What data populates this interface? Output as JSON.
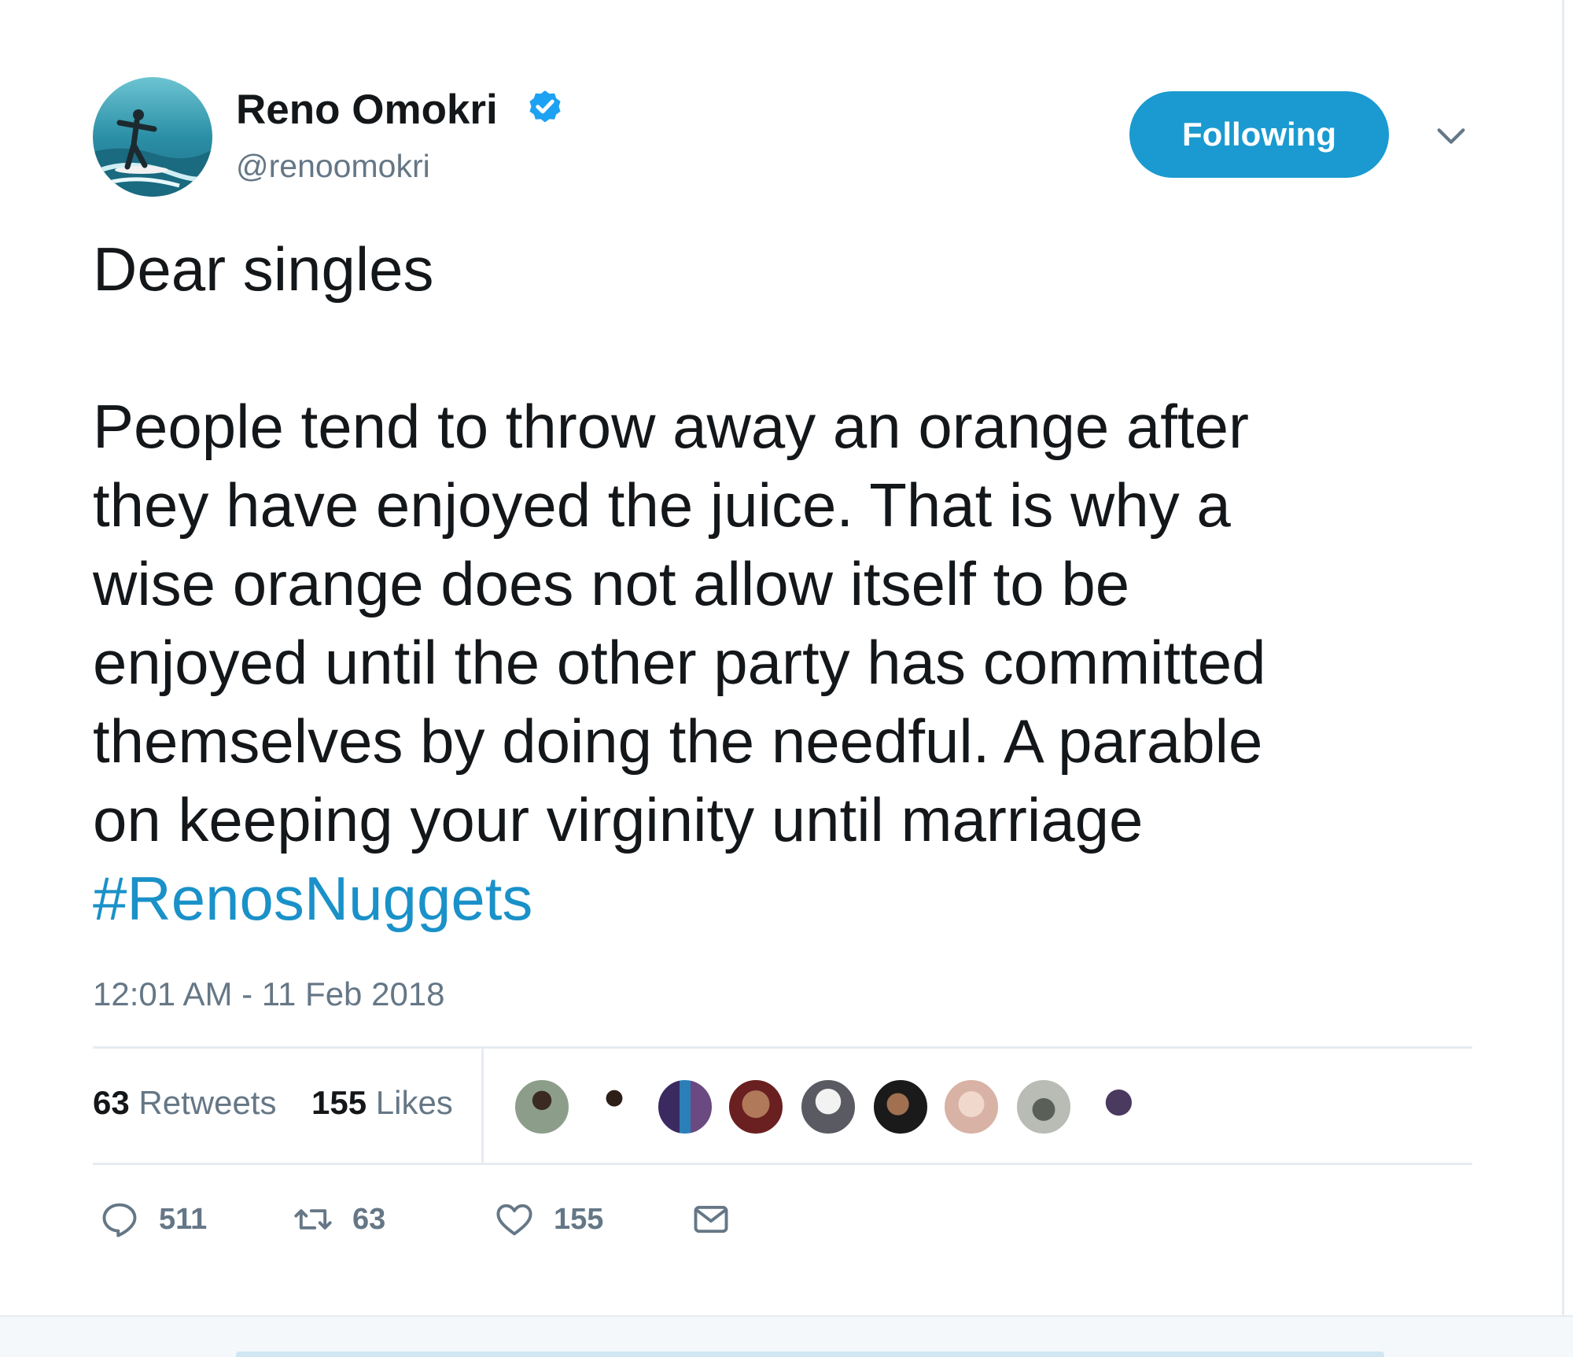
{
  "tweet": {
    "author": {
      "name": "Reno Omokri",
      "handle": "@renoomokri",
      "verified": true,
      "avatar_icon": "surfer-avatar"
    },
    "follow_button_label": "Following",
    "text_lines": [
      "Dear singles",
      "People tend to throw away an orange after",
      "they have enjoyed the juice. That is why a",
      "wise orange does not allow itself to be",
      "enjoyed until the other party has committed",
      "themselves by doing the needful. A parable",
      "on keeping your virginity until marriage"
    ],
    "hashtag": "#RenosNuggets",
    "timestamp": "12:01 AM - 11 Feb 2018",
    "stats": {
      "retweets_count": "63",
      "retweets_label": "Retweets",
      "likes_count": "155",
      "likes_label": "Likes"
    },
    "actions": {
      "reply_count": "511",
      "retweet_count": "63",
      "like_count": "155"
    }
  },
  "colors": {
    "follow_button": "#1a9ad0",
    "hashtag": "#1a91c8",
    "verified": "#1da1f2",
    "muted_text": "#657786",
    "text": "#14171a",
    "divider": "#e6ecf0"
  },
  "icons": [
    "verified-badge-icon",
    "chevron-down-icon",
    "reply-icon",
    "retweet-icon",
    "like-icon",
    "direct-message-icon"
  ]
}
